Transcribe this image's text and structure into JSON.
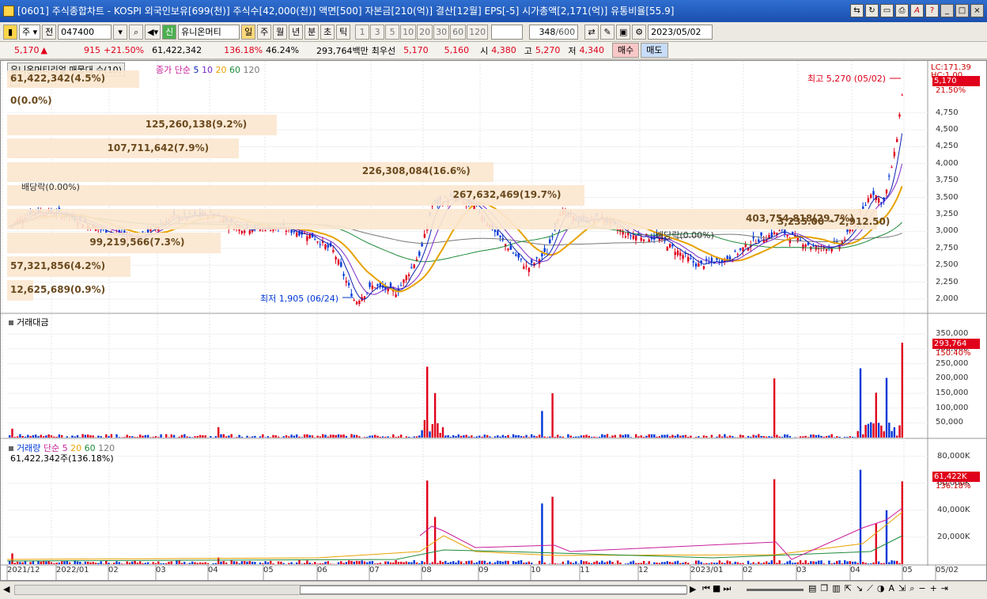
{
  "window": {
    "title": "[0601] 주식종합차트 - KOSPI 외국인보유[699(천)] 주식수[42,000(천)] 액면[500] 자본금[210(억)] 결산[12월] EPS[-5] 시가총액[2,171(억)] 유통비율[55.9]"
  },
  "toolbar": {
    "market": "주",
    "prev": "전",
    "code": "047400",
    "stock_name": "유니온머티",
    "period_day": "일",
    "period_week": "주",
    "period_month": "월",
    "period_year": "년",
    "period_min": "분",
    "period_sec": "초",
    "period_tick": "틱",
    "intervals": [
      "1",
      "3",
      "5",
      "10",
      "20",
      "30",
      "60",
      "120"
    ],
    "count": "348",
    "count_total": "/600",
    "date": "2023/05/02",
    "flag": "신"
  },
  "quote": {
    "price": "5,170",
    "change": "915",
    "change_pct": "+21.50%",
    "volume": "61,422,342",
    "vol_ratio": "136.18%",
    "turnover": "46.24%",
    "amount": "293,764백만",
    "pref_label": "최우선",
    "pref1": "5,170",
    "pref2": "5,160",
    "open_label": "시",
    "open": "4,380",
    "high_label": "고",
    "high": "5,270",
    "low_label": "저",
    "low": "4,340",
    "buy": "매수",
    "sell": "매도"
  },
  "price_pane": {
    "title": "유니온머티리얼 매물대 수(10)",
    "ma_label": "종가 단순",
    "ma": [
      "5",
      "10",
      "20",
      "60",
      "120"
    ],
    "lc": "LC:171.39",
    "hc": "HC:1.00",
    "cur_price": "5,170",
    "cur_pct": "21.50%",
    "high_note": "최고 5,270 (05/02)",
    "low_note": "최저 1,905 (06/24)",
    "dividend1": "배당락(0.00%)",
    "dividend2": "배당락(0.00%)",
    "range_note": "3,235.00 ~ 2,912.50)",
    "y_ticks": [
      "4,750",
      "4,500",
      "4,250",
      "4,000",
      "3,750",
      "3,500",
      "3,250",
      "3,000",
      "2,750",
      "2,500",
      "2,250",
      "2,000"
    ],
    "volume_profile": [
      {
        "label": "61,422,342(4.5%)",
        "pct": 4.5
      },
      {
        "label": "0(0.0%)",
        "pct": 0.0
      },
      {
        "label": "125,260,138(9.2%)",
        "pct": 9.2
      },
      {
        "label": "107,711,642(7.9%)",
        "pct": 7.9
      },
      {
        "label": "226,308,084(16.6%)",
        "pct": 16.6
      },
      {
        "label": "267,632,469(19.7%)",
        "pct": 19.7
      },
      {
        "label": "403,754,818(29.7%)",
        "pct": 29.7
      },
      {
        "label": "99,219,566(7.3%)",
        "pct": 7.3
      },
      {
        "label": "57,321,856(4.2%)",
        "pct": 4.2
      },
      {
        "label": "12,625,689(0.9%)",
        "pct": 0.9
      }
    ]
  },
  "amount_pane": {
    "title": "거래대금",
    "cur": "293,764",
    "y_ticks": [
      "350,000",
      "300,000",
      "250,000",
      "200,000",
      "150,000",
      "100,000",
      "50,000"
    ]
  },
  "volume_pane": {
    "title": "거래량",
    "ma_label": "단순",
    "ma": [
      "5",
      "20",
      "60",
      "120"
    ],
    "sub": "61,422,342주(136.18%)",
    "cur": "61,422K",
    "cur_pct": "136.18%",
    "y_ticks": [
      "80,000K",
      "60,000K",
      "40,000K",
      "20,000K"
    ]
  },
  "x_axis": [
    "2021/12",
    "2022/01",
    "02",
    "03",
    "04",
    "05",
    "06",
    "07",
    "08",
    "09",
    "10",
    "11",
    "12",
    "2023/01",
    "02",
    "03",
    "04",
    "05",
    "05/02"
  ],
  "colors": {
    "up": "#e0001b",
    "down": "#0038d8",
    "ma5": "#0a1fae",
    "ma10": "#7b28c8",
    "ma20": "#e8a200",
    "ma60": "#1e8a3a",
    "ma120": "#777777"
  }
}
